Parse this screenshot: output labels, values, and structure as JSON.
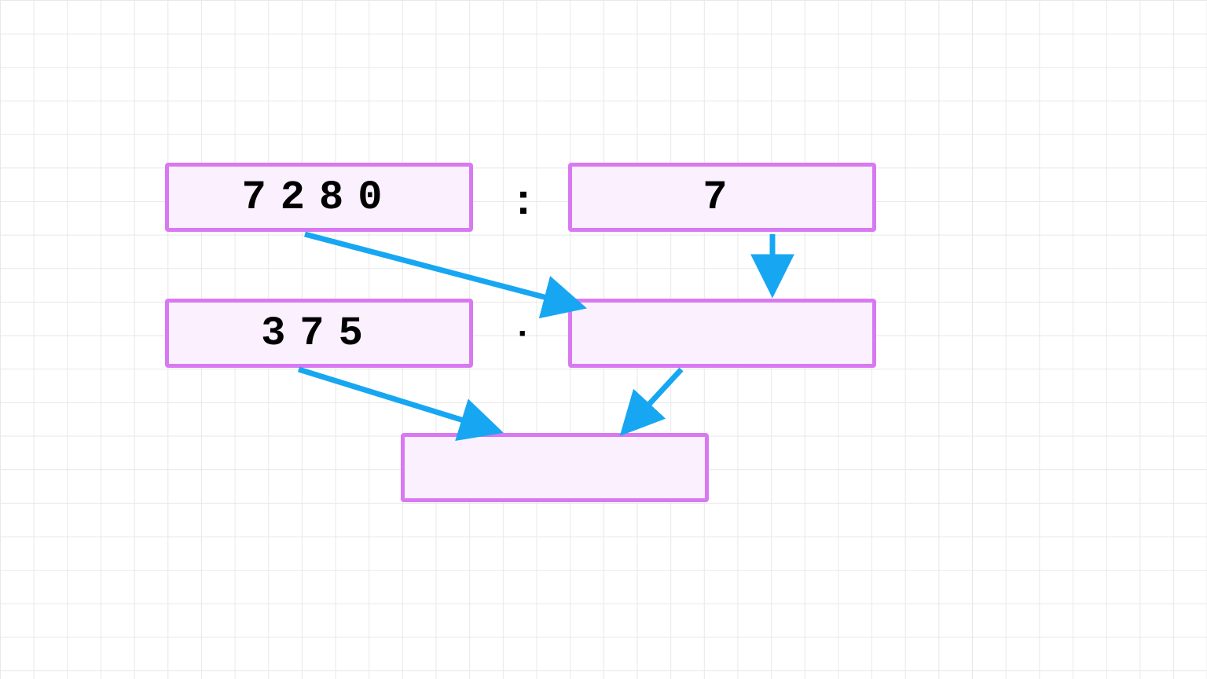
{
  "boxes": {
    "top_left": {
      "value": "7280"
    },
    "top_right": {
      "value": "7"
    },
    "mid_left": {
      "value": "375"
    },
    "mid_right": {
      "value": ""
    },
    "bottom": {
      "value": ""
    }
  },
  "operators": {
    "row1": ":",
    "row2": "·"
  },
  "colors": {
    "box_border": "#d979f2",
    "box_fill": "#fbf0fe",
    "arrow": "#17a7f2",
    "grid": "#e8e8e8"
  }
}
